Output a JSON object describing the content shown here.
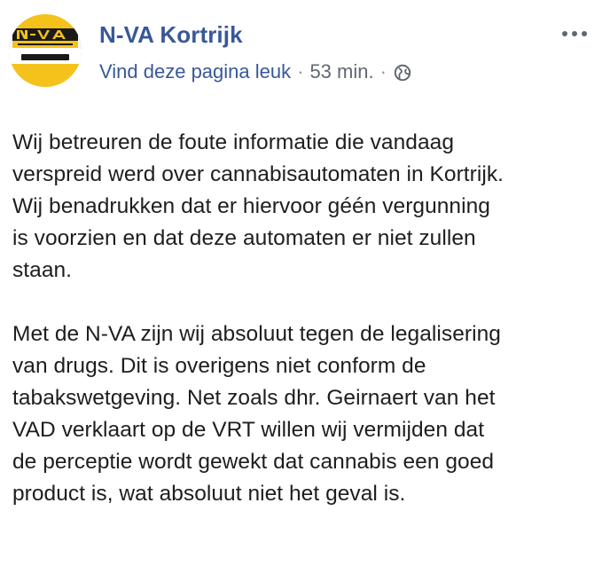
{
  "post": {
    "page_name": "N-VA Kortrijk",
    "like_link": "Vind deze pagina leuk",
    "separator": "·",
    "time": "53 min.",
    "privacy_icon": "globe-icon",
    "more_icon": "more-options-icon",
    "avatar": {
      "logo_text": "N-VA",
      "slogan": "DE VERANDERING WERKT",
      "place": "KORTRIJK",
      "colors": {
        "yellow": "#f5c21b",
        "black": "#1a1a1a",
        "white": "#ffffff"
      }
    },
    "paragraphs": [
      {
        "lines": [
          "Wij betreuren de foute informatie die vandaag",
          "verspreid werd over cannabisautomaten in Kortrijk.",
          "Wij benadrukken dat er hiervoor géén vergunning",
          "is voorzien en dat deze automaten er niet zullen",
          "staan."
        ]
      },
      {
        "lines": [
          "Met de N-VA zijn wij absoluut tegen de legalisering",
          "van drugs. Dit is overigens niet conform de",
          "tabakswetgeving. Net zoals dhr. Geirnaert van het",
          "VAD verklaart op de VRT willen wij vermijden dat",
          "de perceptie wordt gewekt dat cannabis een goed",
          "product is, wat absoluut niet het geval is."
        ]
      }
    ]
  },
  "colors": {
    "link_blue": "#385898",
    "meta_gray": "#616770",
    "text": "#1c1e21"
  }
}
